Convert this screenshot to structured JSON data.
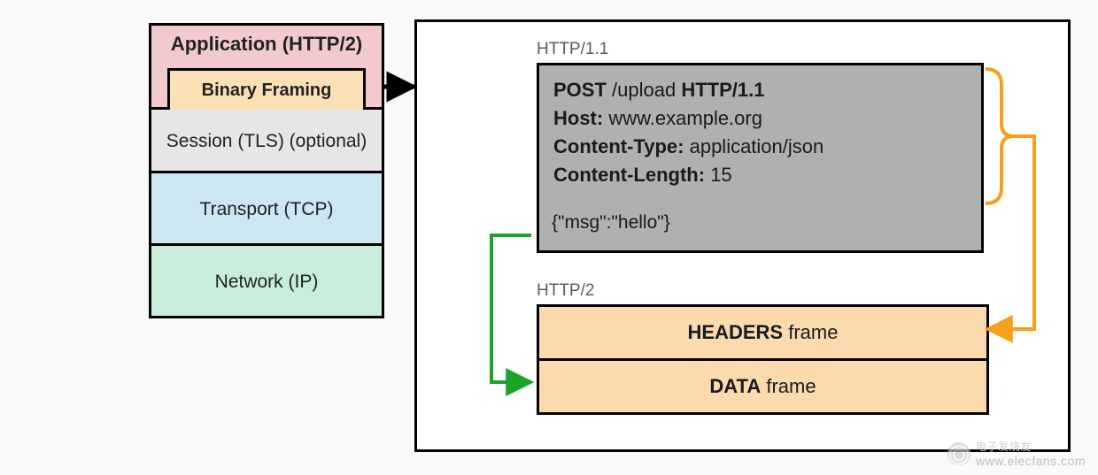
{
  "stack": {
    "application_title": "Application (HTTP/2)",
    "binary_framing": "Binary Framing",
    "session": "Session (TLS) (optional)",
    "transport": "Transport (TCP)",
    "network": "Network (IP)"
  },
  "panel": {
    "http11_label": "HTTP/1.1",
    "http2_label": "HTTP/2",
    "request": {
      "method": "POST",
      "path": "/upload",
      "version": "HTTP/1.1",
      "host_label": "Host:",
      "host_value": "www.example.org",
      "ctype_label": "Content-Type:",
      "ctype_value": "application/json",
      "clen_label": "Content-Length:",
      "clen_value": "15",
      "body": "{\"msg\":\"hello\"}"
    },
    "frames": {
      "headers_name": "HEADERS",
      "headers_suffix": " frame",
      "data_name": "DATA",
      "data_suffix": " frame"
    }
  },
  "watermark": {
    "cn": "电子发烧友",
    "url": "www.elecfans.com"
  },
  "colors": {
    "arrow_headers": "#f6a01a",
    "arrow_data": "#1aa52a",
    "arrow_black": "#000000"
  }
}
